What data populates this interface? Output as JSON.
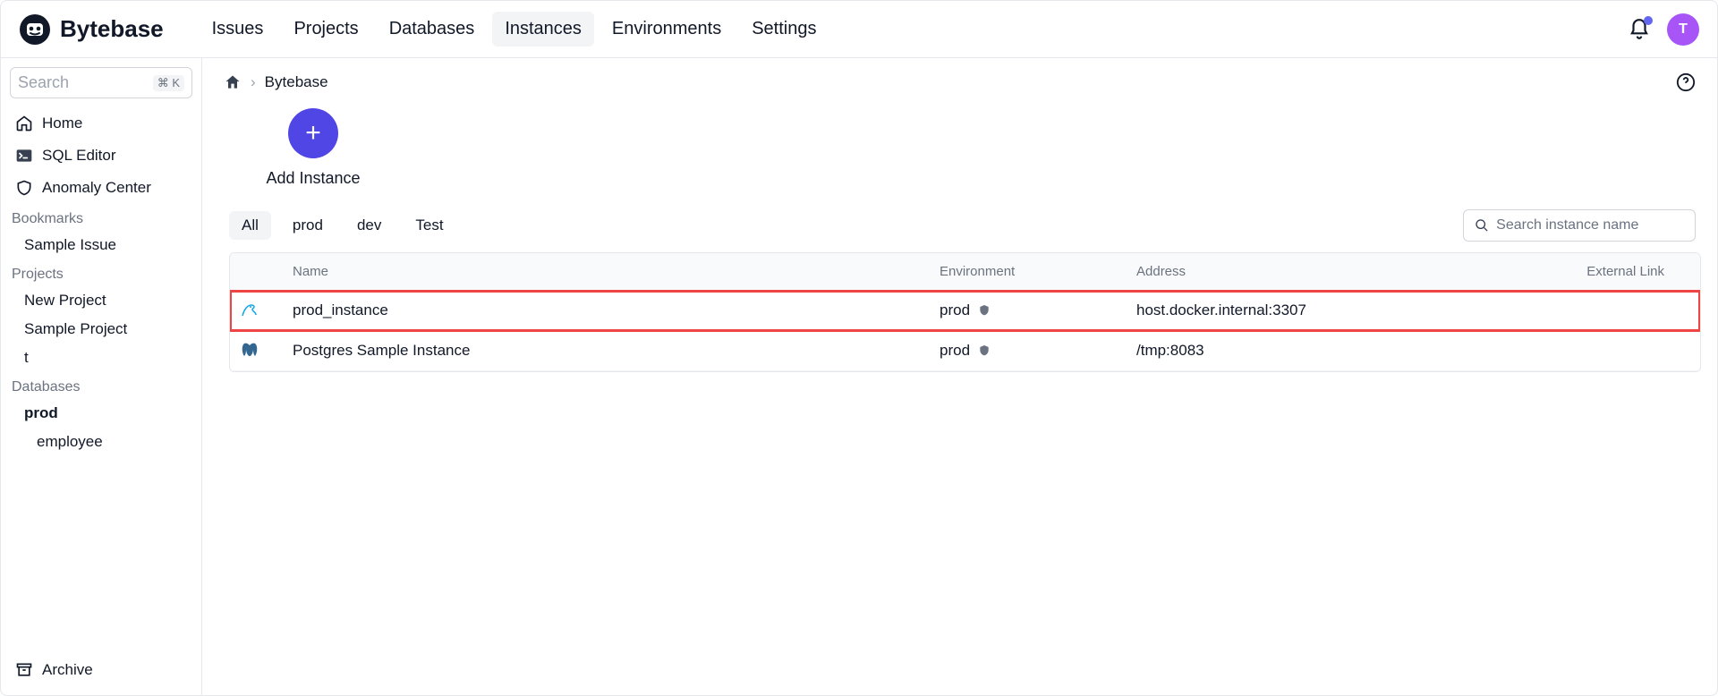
{
  "brand": "Bytebase",
  "nav": {
    "items": [
      "Issues",
      "Projects",
      "Databases",
      "Instances",
      "Environments",
      "Settings"
    ],
    "active_index": 3
  },
  "user": {
    "initial": "T"
  },
  "sidebar": {
    "search_placeholder": "Search",
    "kbd": "⌘ K",
    "main": [
      {
        "label": "Home"
      },
      {
        "label": "SQL Editor"
      },
      {
        "label": "Anomaly Center"
      }
    ],
    "sections": [
      {
        "title": "Bookmarks",
        "items": [
          "Sample Issue"
        ]
      },
      {
        "title": "Projects",
        "items": [
          "New Project",
          "Sample Project",
          "t"
        ]
      },
      {
        "title": "Databases",
        "items": [
          "prod",
          "employee"
        ]
      }
    ],
    "archive": "Archive"
  },
  "breadcrumb": {
    "current": "Bytebase"
  },
  "add_instance_label": "Add Instance",
  "filter_tabs": [
    "All",
    "prod",
    "dev",
    "Test"
  ],
  "filter_active_index": 0,
  "search_instance_placeholder": "Search instance name",
  "table": {
    "headers": {
      "name": "Name",
      "env": "Environment",
      "addr": "Address",
      "ext": "External Link"
    },
    "rows": [
      {
        "icon": "mysql",
        "name": "prod_instance",
        "env": "prod",
        "addr": "host.docker.internal:3307",
        "highlight": true
      },
      {
        "icon": "postgres",
        "name": "Postgres Sample Instance",
        "env": "prod",
        "addr": "/tmp:8083",
        "highlight": false
      }
    ]
  }
}
